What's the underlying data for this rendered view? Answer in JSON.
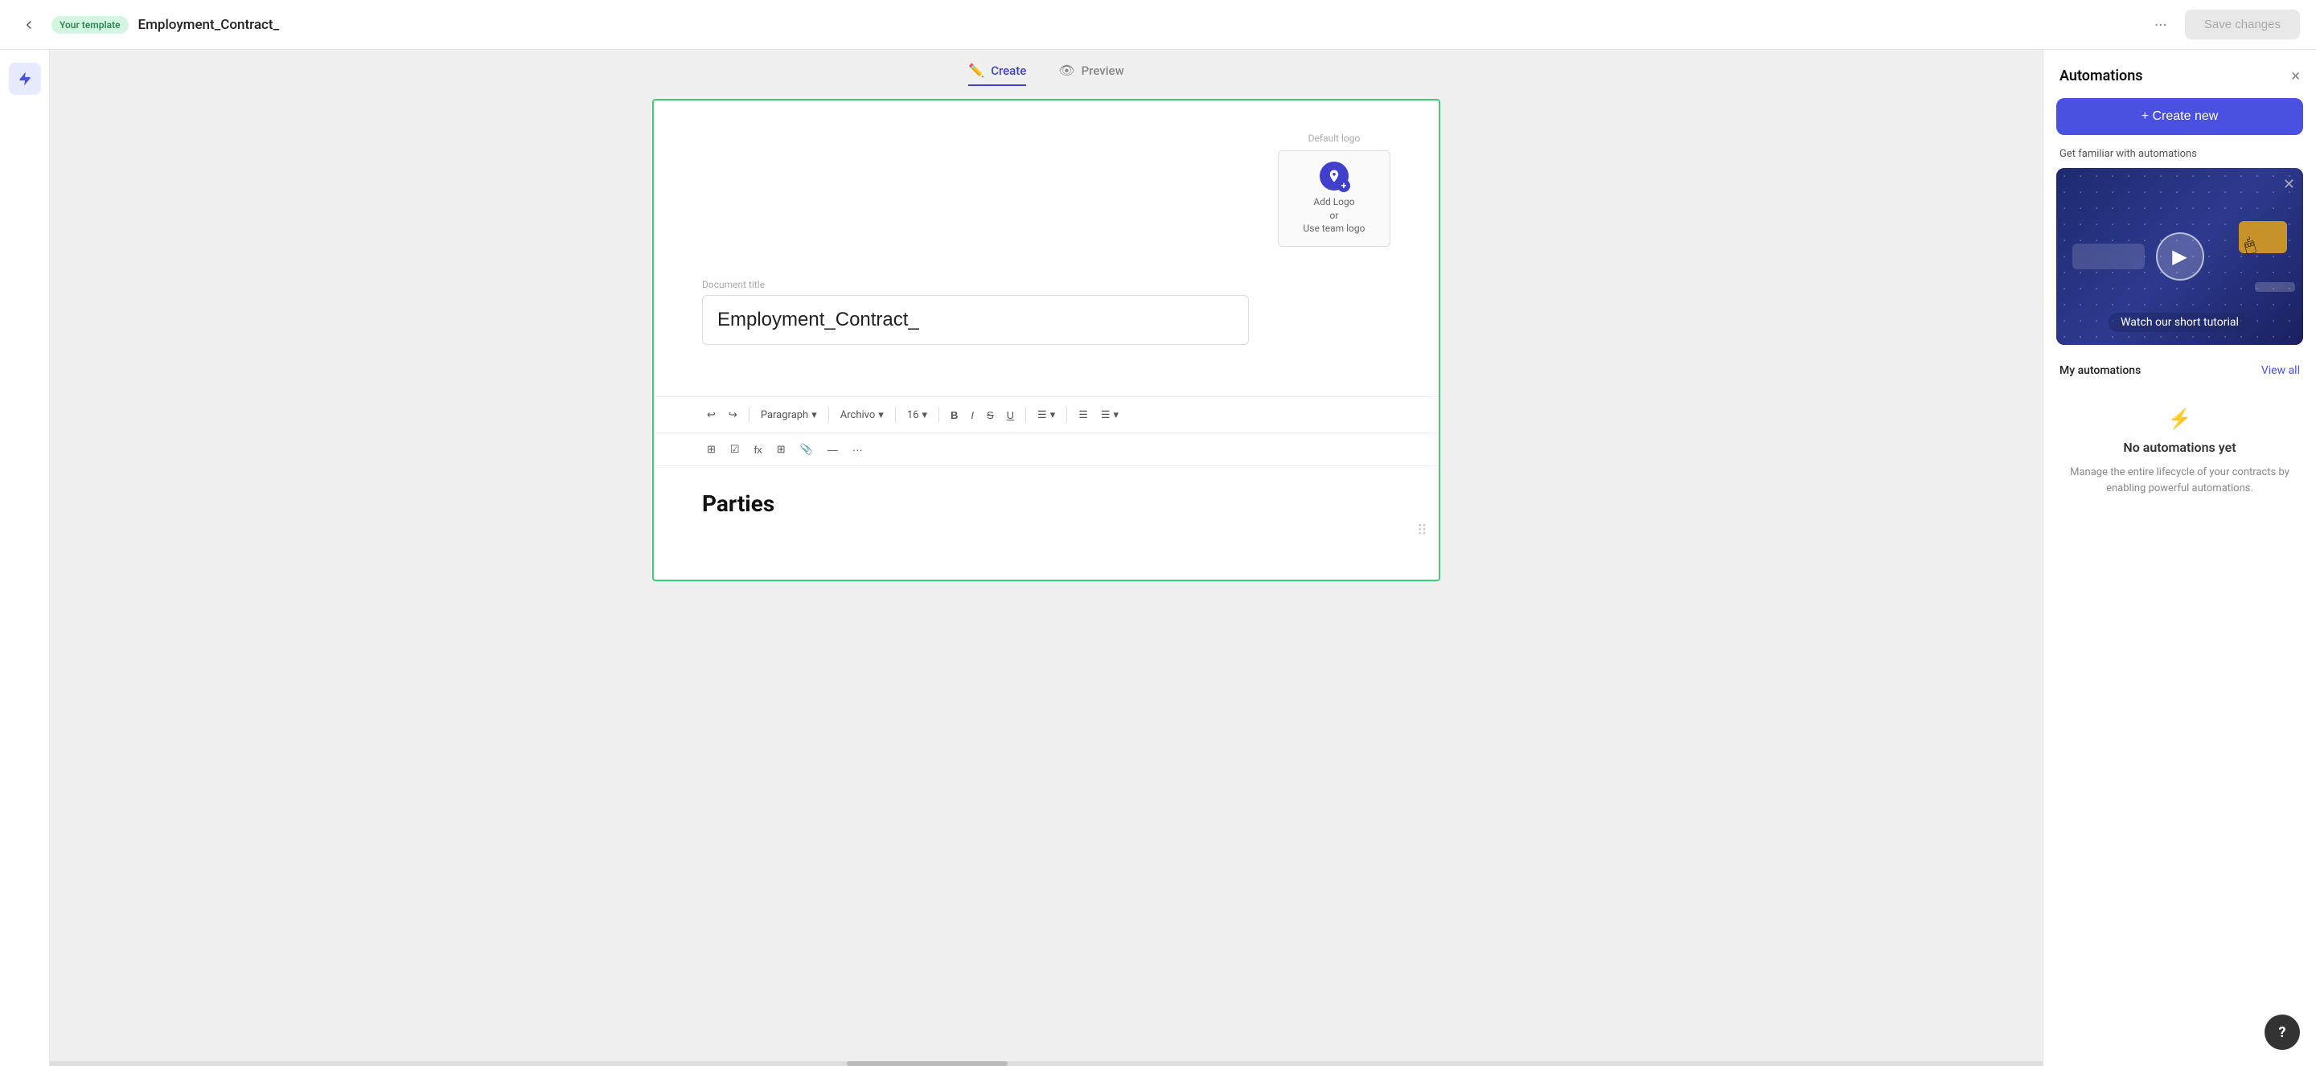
{
  "header": {
    "badge_label": "Your template",
    "title": "Employment_Contract_",
    "more_icon": "ellipsis-icon",
    "save_label": "Save changes"
  },
  "editor": {
    "tab_create": "Create",
    "tab_preview": "Preview",
    "doc_title_label": "Document title",
    "doc_title_value": "Employment_Contract_",
    "logo_label": "Default logo",
    "logo_upload_line1": "Add Logo",
    "logo_upload_line2": "or",
    "logo_upload_line3": "Use team logo",
    "toolbar": {
      "undo": "↩",
      "redo": "↪",
      "paragraph": "Paragraph",
      "font": "Archivo",
      "size": "16",
      "bold": "B",
      "italic": "I",
      "strikethrough": "S",
      "underline": "U",
      "align": "≡",
      "list_bullet": "≡",
      "list_number": "≡"
    },
    "body_heading": "Parties"
  },
  "automations_panel": {
    "title": "Automations",
    "close_icon": "×",
    "create_new_label": "+ Create new",
    "familiar_label": "Get familiar with automations",
    "tutorial_label": "Watch our short tutorial",
    "my_automations_label": "My automations",
    "view_all_label": "View all",
    "empty_title": "No automations yet",
    "empty_desc": "Manage the entire lifecycle of your contracts by enabling powerful automations."
  },
  "help": {
    "label": "?"
  }
}
